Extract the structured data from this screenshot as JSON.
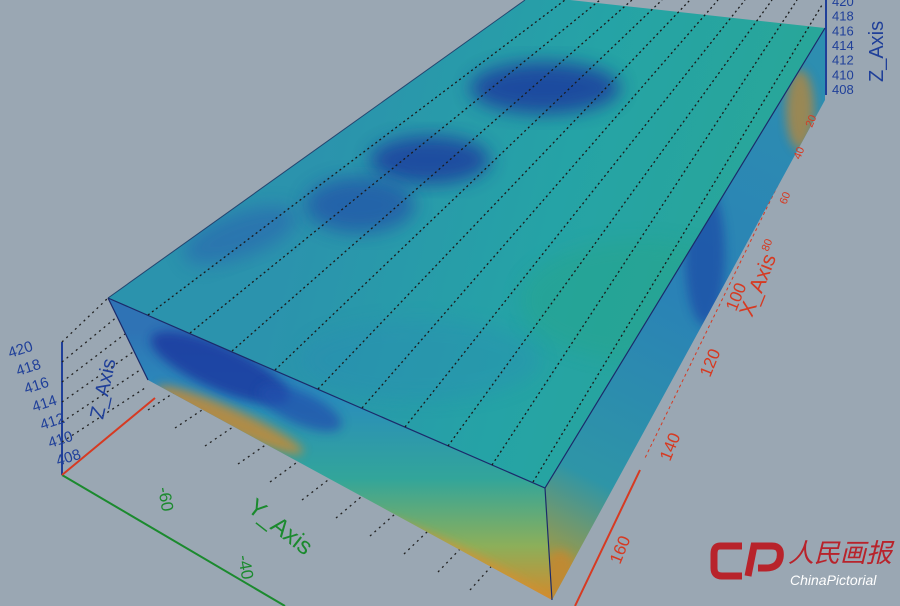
{
  "chart_data": {
    "type": "3d-volume",
    "title": "",
    "axes": {
      "x": {
        "label": "X_Axis",
        "ticks": [
          "20",
          "40",
          "60",
          "80",
          "100",
          "120",
          "140",
          "160"
        ],
        "range": [
          0,
          170
        ]
      },
      "y": {
        "label": "Y_Axis",
        "ticks": [
          "-60",
          "-40"
        ]
      },
      "z": {
        "label": "Z_Axis",
        "ticks": [
          "408",
          "410",
          "412",
          "414",
          "416",
          "418",
          "420"
        ],
        "range": [
          408,
          420
        ]
      }
    },
    "grid": "dotted",
    "colors": {
      "low": "#1b3fa3",
      "mid": "#27a39d",
      "high": "#d8892a",
      "x_axis": "#d63a22",
      "y_axis": "#1b8a2e",
      "z_axis": "#1f3f99"
    }
  },
  "watermark": {
    "chinese": "人民画报",
    "english": "ChinaPictorial"
  }
}
